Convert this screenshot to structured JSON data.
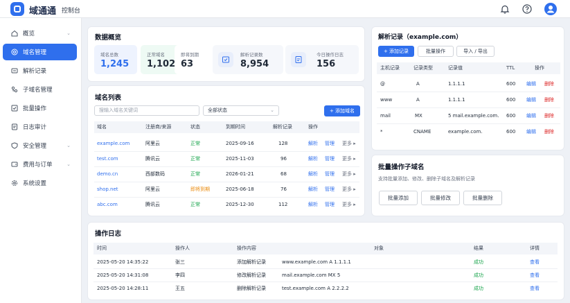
{
  "header": {
    "brand": "域通通",
    "subtitle": "控制台",
    "icons": [
      "bell-icon",
      "help-icon",
      "user-icon"
    ]
  },
  "sidebar": {
    "items": [
      {
        "label": "概览",
        "icon": "home-icon",
        "chevron": true
      },
      {
        "label": "域名管理",
        "icon": "globe-icon",
        "active": true
      },
      {
        "label": "解析记录",
        "icon": "dns-icon"
      },
      {
        "label": "子域名管理",
        "icon": "subdomain-icon"
      },
      {
        "label": "批量操作",
        "icon": "batch-icon"
      },
      {
        "label": "日志审计",
        "icon": "log-icon"
      },
      {
        "label": "安全管理",
        "icon": "shield-icon",
        "chevron": true
      },
      {
        "label": "费用与订单",
        "icon": "wallet-icon",
        "chevron": true
      },
      {
        "label": "系统设置",
        "icon": "gear-icon"
      }
    ]
  },
  "overview": {
    "title": "数据概览",
    "stats": [
      {
        "label": "域名总数",
        "value": "1,245",
        "color": "#2f6fed"
      },
      {
        "label": "正常域名",
        "value": "1,102",
        "color": "#1f2937"
      },
      {
        "label": "即将到期",
        "value": "63",
        "color": "#111827"
      },
      {
        "label": "解析记录数",
        "value": "8,954",
        "color": "#111827"
      },
      {
        "label": "今日操作日志",
        "value": "156",
        "color": "#111827"
      }
    ]
  },
  "domains": {
    "title": "域名列表",
    "search_placeholder": "搜输入域名关键词",
    "status_filter": "全部状态",
    "add_button": "+ 添加域名",
    "columns": [
      "域名",
      "注册商/来源",
      "状态",
      "到期时间",
      "解析记录",
      "操作"
    ],
    "rows": [
      {
        "domain": "example.com",
        "registrar": "阿里云",
        "status": "正常",
        "status_type": "ok",
        "expires": "2025-09-16",
        "records": "128"
      },
      {
        "domain": "test.com",
        "registrar": "腾讯云",
        "status": "正常",
        "status_type": "ok",
        "expires": "2025-11-03",
        "records": "96"
      },
      {
        "domain": "demo.cn",
        "registrar": "西部数码",
        "status": "正常",
        "status_type": "ok",
        "expires": "2026-01-21",
        "records": "68"
      },
      {
        "domain": "shop.net",
        "registrar": "阿里云",
        "status": "即将到期",
        "status_type": "warn",
        "expires": "2025-06-18",
        "records": "76"
      },
      {
        "domain": "abc.com",
        "registrar": "腾讯云",
        "status": "正常",
        "status_type": "ok",
        "expires": "2025-12-30",
        "records": "112"
      }
    ],
    "actions": {
      "resolve": "解析",
      "manage": "管理",
      "more": "更多 ▸"
    }
  },
  "dns": {
    "title": "解析记录（example.com）",
    "buttons": {
      "add": "+ 添加记录",
      "batch": "批量操作",
      "import_export": "导入 / 导出"
    },
    "columns": [
      "主机记录",
      "记录类型",
      "记录值",
      "TTL",
      "操作"
    ],
    "rows": [
      {
        "host": "@",
        "type": "A",
        "value": "1.1.1.1",
        "ttl": "600"
      },
      {
        "host": "www",
        "type": "A",
        "value": "1.1.1.1",
        "ttl": "600"
      },
      {
        "host": "mail",
        "type": "MX",
        "value": "5 mail.example.com.",
        "ttl": "600"
      },
      {
        "host": "*",
        "type": "CNAME",
        "value": "example.com.",
        "ttl": "600"
      }
    ],
    "actions": {
      "edit": "编辑",
      "delete": "删除"
    }
  },
  "batch": {
    "title": "批量操作子域名",
    "desc": "支持批量添加、修改、删除子域名及解析记录",
    "buttons": [
      "批量添加",
      "批量修改",
      "批量删除"
    ]
  },
  "logs": {
    "title": "操作日志",
    "columns": [
      "时间",
      "操作人",
      "操作内容",
      "对象",
      "结果",
      "详情"
    ],
    "rows": [
      {
        "time": "2025-05-20 14:35:22",
        "user": "张三",
        "action": "添加解析记录",
        "target": "www.example.com  A 1.1.1.1",
        "result": "成功",
        "detail": "查看"
      },
      {
        "time": "2025-05-20 14:31:08",
        "user": "李四",
        "action": "修改解析记录",
        "target": "mail.example.com  MX 5",
        "result": "成功",
        "detail": "查看"
      },
      {
        "time": "2025-05-20 14:28:11",
        "user": "王五",
        "action": "删除解析记录",
        "target": "test.example.com  A 2.2.2.2",
        "result": "成功",
        "detail": "查看"
      }
    ]
  }
}
